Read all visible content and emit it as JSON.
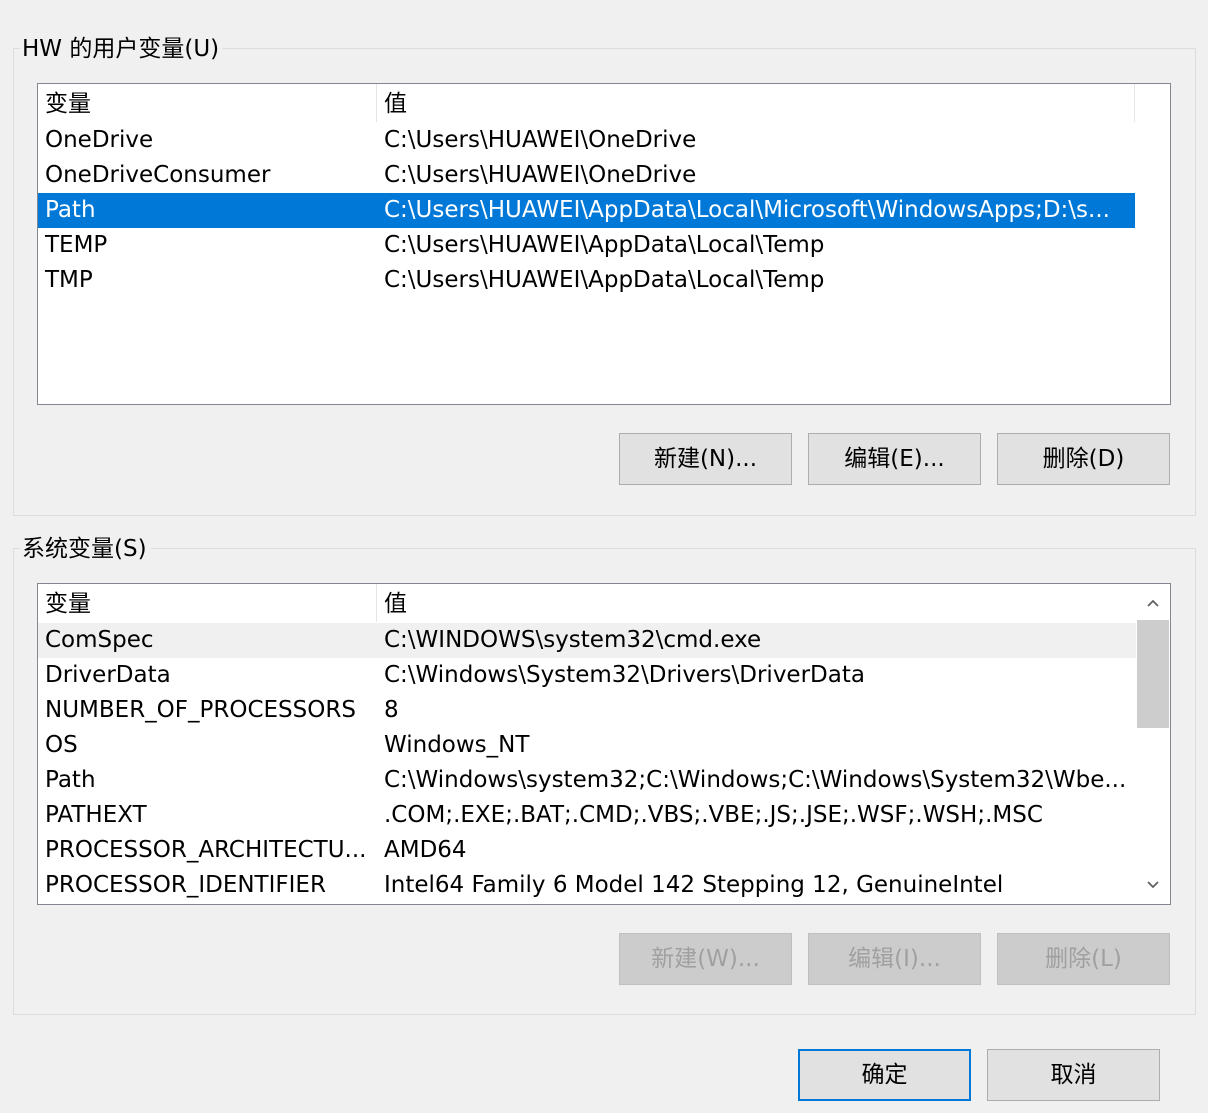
{
  "user_vars": {
    "title": "HW 的用户变量(U)",
    "col_name": "变量",
    "col_value": "值",
    "rows": [
      {
        "name": "OneDrive",
        "value": "C:\\Users\\HUAWEI\\OneDrive"
      },
      {
        "name": "OneDriveConsumer",
        "value": "C:\\Users\\HUAWEI\\OneDrive"
      },
      {
        "name": "Path",
        "value": "C:\\Users\\HUAWEI\\AppData\\Local\\Microsoft\\WindowsApps;D:\\s..."
      },
      {
        "name": "TEMP",
        "value": "C:\\Users\\HUAWEI\\AppData\\Local\\Temp"
      },
      {
        "name": "TMP",
        "value": "C:\\Users\\HUAWEI\\AppData\\Local\\Temp"
      }
    ],
    "selected_row": "Path",
    "new_label": "新建(N)...",
    "edit_label": "编辑(E)...",
    "delete_label": "删除(D)"
  },
  "system_vars": {
    "title": "系统变量(S)",
    "col_name": "变量",
    "col_value": "值",
    "rows": [
      {
        "name": "ComSpec",
        "value": "C:\\WINDOWS\\system32\\cmd.exe"
      },
      {
        "name": "DriverData",
        "value": "C:\\Windows\\System32\\Drivers\\DriverData"
      },
      {
        "name": "NUMBER_OF_PROCESSORS",
        "value": "8"
      },
      {
        "name": "OS",
        "value": "Windows_NT"
      },
      {
        "name": "Path",
        "value": "C:\\Windows\\system32;C:\\Windows;C:\\Windows\\System32\\Wbe..."
      },
      {
        "name": "PATHEXT",
        "value": ".COM;.EXE;.BAT;.CMD;.VBS;.VBE;.JS;.JSE;.WSF;.WSH;.MSC"
      },
      {
        "name": "PROCESSOR_ARCHITECTU...",
        "value": "AMD64"
      },
      {
        "name": "PROCESSOR_IDENTIFIER",
        "value": "Intel64 Family 6 Model 142 Stepping 12, GenuineIntel"
      }
    ],
    "hover_row": "ComSpec",
    "new_label": "新建(W)...",
    "edit_label": "编辑(I)...",
    "delete_label": "删除(L)"
  },
  "dialog": {
    "ok_label": "确定",
    "cancel_label": "取消"
  },
  "colors": {
    "selection": "#0078d7",
    "disabled_text": "#a0a0a0"
  },
  "icons": {
    "scroll_up": "chevron-up-icon",
    "scroll_down": "chevron-down-icon"
  }
}
